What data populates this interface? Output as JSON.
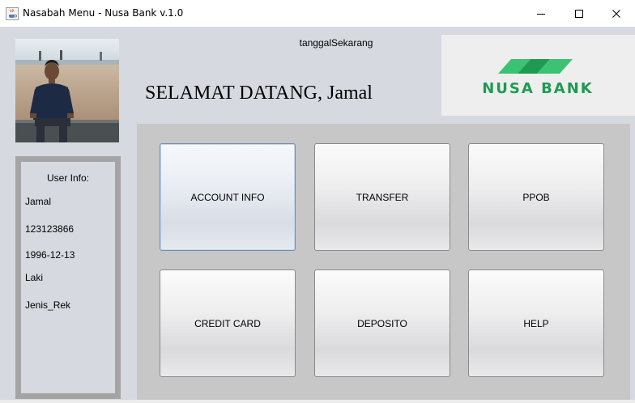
{
  "window": {
    "title": "Nasabah Menu - Nusa Bank v.1.0",
    "icon": "java-coffee-icon",
    "controls": [
      "minimize-icon",
      "maximize-icon",
      "close-icon"
    ]
  },
  "header": {
    "date_label": "tanggalSekarang",
    "welcome_prefix": "SELAMAT DATANG,",
    "welcome_name": "Jamal"
  },
  "logo": {
    "text": "NUSA BANK",
    "colors": {
      "green_dark": "#1f9a52",
      "green_light": "#3bc273"
    }
  },
  "user_info": {
    "title": "User Info:",
    "name": "Jamal",
    "account_number": "123123866",
    "birth_date": "1996-12-13",
    "gender": "Laki",
    "account_type": "Jenis_Rek"
  },
  "menu": {
    "account_info": "ACCOUNT INFO",
    "transfer": "TRANSFER",
    "ppob": "PPOB",
    "credit_card": "CREDIT CARD",
    "deposito": "DEPOSITO",
    "help": "HELP"
  }
}
